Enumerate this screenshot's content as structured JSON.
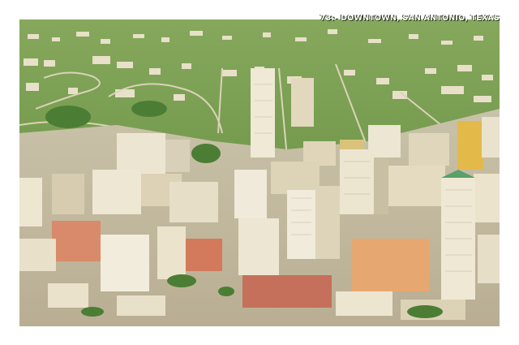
{
  "postcard": {
    "caption": "73:- DOWNTOWN, SAN ANTONIO, TEXAS"
  }
}
